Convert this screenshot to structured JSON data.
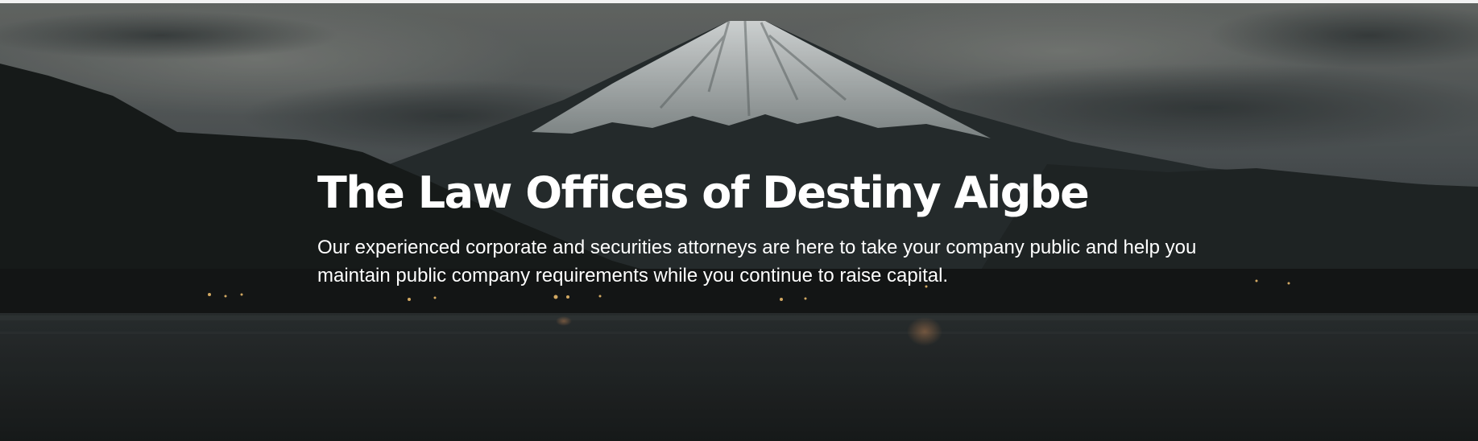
{
  "hero": {
    "title": "The Law Offices of Destiny Aigbe",
    "subtitle": "Our experienced corporate and securities attorneys are here to take your company public and help you maintain public company requirements while you continue to raise capital.",
    "background_image": "mountain-lake-photo"
  },
  "colors": {
    "text": "#ffffff",
    "overlay": "#1c1f1f"
  }
}
